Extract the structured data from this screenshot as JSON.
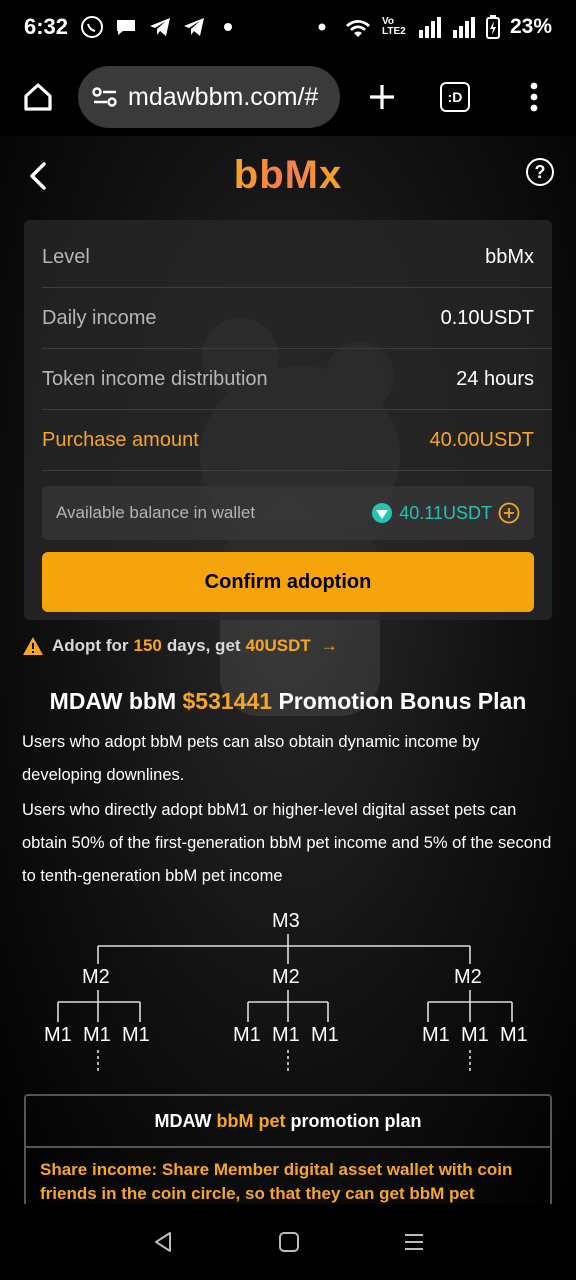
{
  "status": {
    "time": "6:32",
    "battery_percent": "23%",
    "network_label": "Vo LTE2"
  },
  "browser": {
    "url": "mdawbbm.com/#",
    "tab_switcher_label": ":D"
  },
  "header": {
    "brand": "bbMx",
    "help": "?"
  },
  "card": {
    "rows": [
      {
        "label": "Level",
        "value": "bbMx"
      },
      {
        "label": "Daily income",
        "value": "0.10USDT"
      },
      {
        "label": "Token income distribution",
        "value": "24 hours"
      },
      {
        "label": "Purchase amount",
        "value": "40.00USDT"
      }
    ],
    "balance_label": "Available balance in wallet",
    "balance_value": "40.11USDT",
    "confirm_label": "Confirm adoption"
  },
  "notice": {
    "prefix": "Adopt for",
    "days": "150",
    "middle": "days, get",
    "amount": "40USDT",
    "arrow": "→"
  },
  "promo": {
    "title_prefix": "MDAW bbM",
    "title_amount": "$531441",
    "title_suffix": "Promotion Bonus Plan",
    "paragraph1": "Users who adopt bbM pets can also obtain dynamic income by developing downlines.",
    "paragraph2": "Users who directly adopt bbM1 or higher-level digital asset pets can obtain 50% of the first-generation bbM pet income and 5% of the second to tenth-generation bbM pet income"
  },
  "tree": {
    "root": "M3",
    "level2": [
      "M2",
      "M2",
      "M2"
    ],
    "level1": [
      "M1",
      "M1",
      "M1",
      "M1",
      "M1",
      "M1",
      "M1",
      "M1",
      "M1"
    ]
  },
  "plan": {
    "head_prefix": "MDAW",
    "head_highlight": "bbM pet",
    "head_suffix": "promotion plan",
    "body": "Share income: Share Member digital asset wallet with coin friends in the coin circle, so that they can get bbM pet income"
  },
  "colors": {
    "accent": "#f5a623",
    "button": "#f5a40c",
    "teal": "#27c2b5",
    "card_bg": "#282828"
  }
}
